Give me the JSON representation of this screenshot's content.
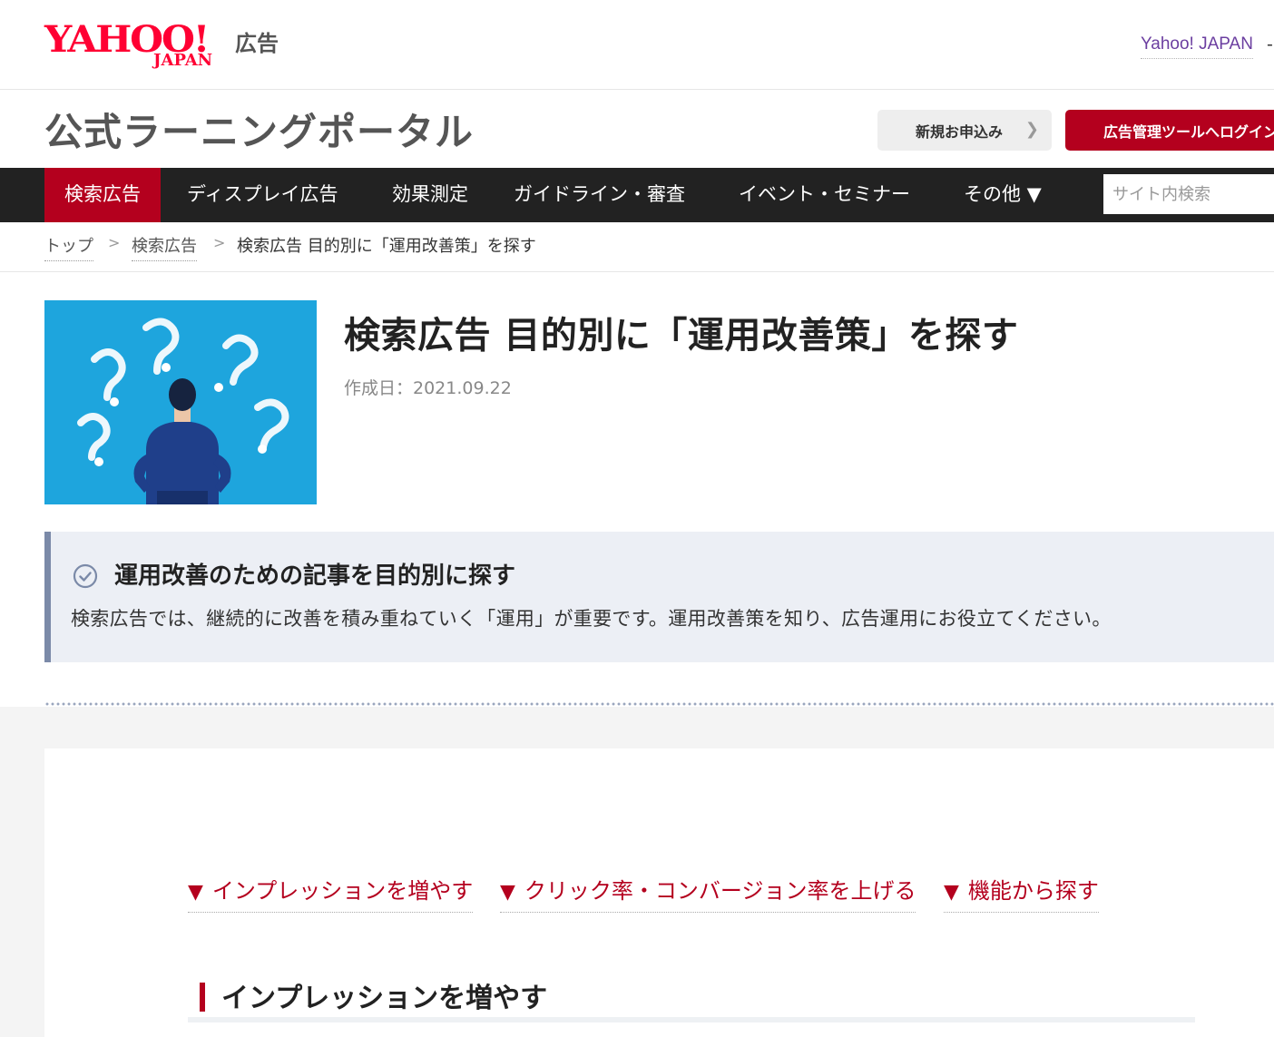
{
  "header": {
    "logo_text": "YAHOO!",
    "logo_sub": "JAPAN",
    "logo_ad": "広告",
    "yahoo_link": "Yahoo! JAPAN",
    "yahoo_dash": "-"
  },
  "portal": {
    "title": "公式ラーニングポータル",
    "apply_button": "新規お申込み",
    "login_button": "広告管理ツールへログイン"
  },
  "nav": {
    "items": [
      {
        "label": "検索広告"
      },
      {
        "label": "ディスプレイ広告"
      },
      {
        "label": "効果測定"
      },
      {
        "label": "ガイドライン・審査"
      },
      {
        "label": "イベント・セミナー"
      },
      {
        "label": "その他 ▼"
      }
    ],
    "search_placeholder": "サイト内検索"
  },
  "breadcrumb": {
    "items": [
      "トップ",
      "検索広告"
    ],
    "separator": ">",
    "current": "検索広告 目的別に「運用改善策」を探す"
  },
  "article": {
    "title": "検索広告 目的別に「運用改善策」を探す",
    "created": "作成日：2021.09.22"
  },
  "info": {
    "title": "運用改善のための記事を目的別に探す",
    "description": "検索広告では、継続的に改善を積み重ねていく「運用」が重要です。運用改善策を知り、広告運用にお役立てください。"
  },
  "anchors": [
    {
      "marker": "▼",
      "label": "インプレッションを増やす"
    },
    {
      "marker": "▼",
      "label": "クリック率・コンバージョン率を上げる"
    },
    {
      "marker": "▼",
      "label": "機能から探す"
    }
  ],
  "section": {
    "title": "インプレッションを増やす"
  },
  "colors": {
    "brand_red": "#b4001e",
    "nav_bg": "#222222",
    "hero_blue": "#1ea5dd"
  }
}
